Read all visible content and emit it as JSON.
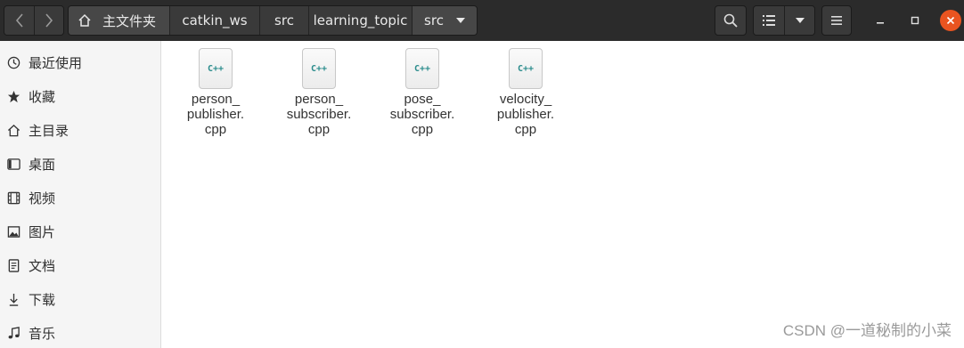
{
  "breadcrumb": {
    "items": [
      "主文件夹",
      "catkin_ws",
      "src",
      "learning_topic",
      "src"
    ]
  },
  "sidebar": {
    "items": [
      {
        "label": "最近使用",
        "icon": "clock-icon"
      },
      {
        "label": "收藏",
        "icon": "star-icon"
      },
      {
        "label": "主目录",
        "icon": "home-icon"
      },
      {
        "label": "桌面",
        "icon": "desktop-icon"
      },
      {
        "label": "视频",
        "icon": "film-icon"
      },
      {
        "label": "图片",
        "icon": "picture-icon"
      },
      {
        "label": "文档",
        "icon": "document-icon"
      },
      {
        "label": "下载",
        "icon": "download-icon"
      },
      {
        "label": "音乐",
        "icon": "music-icon"
      }
    ]
  },
  "files": [
    {
      "icon_label": "C++",
      "name": "person_\npublisher.\ncpp"
    },
    {
      "icon_label": "C++",
      "name": "person_\nsubscriber.\ncpp"
    },
    {
      "icon_label": "C++",
      "name": "pose_\nsubscriber.\ncpp"
    },
    {
      "icon_label": "C++",
      "name": "velocity_\npublisher.\ncpp"
    }
  ],
  "watermark": "CSDN @一道秘制的小菜",
  "colors": {
    "accent_close": "#e95420",
    "titlebar": "#2b2b2b",
    "cpp_text": "#2a8c8c"
  }
}
